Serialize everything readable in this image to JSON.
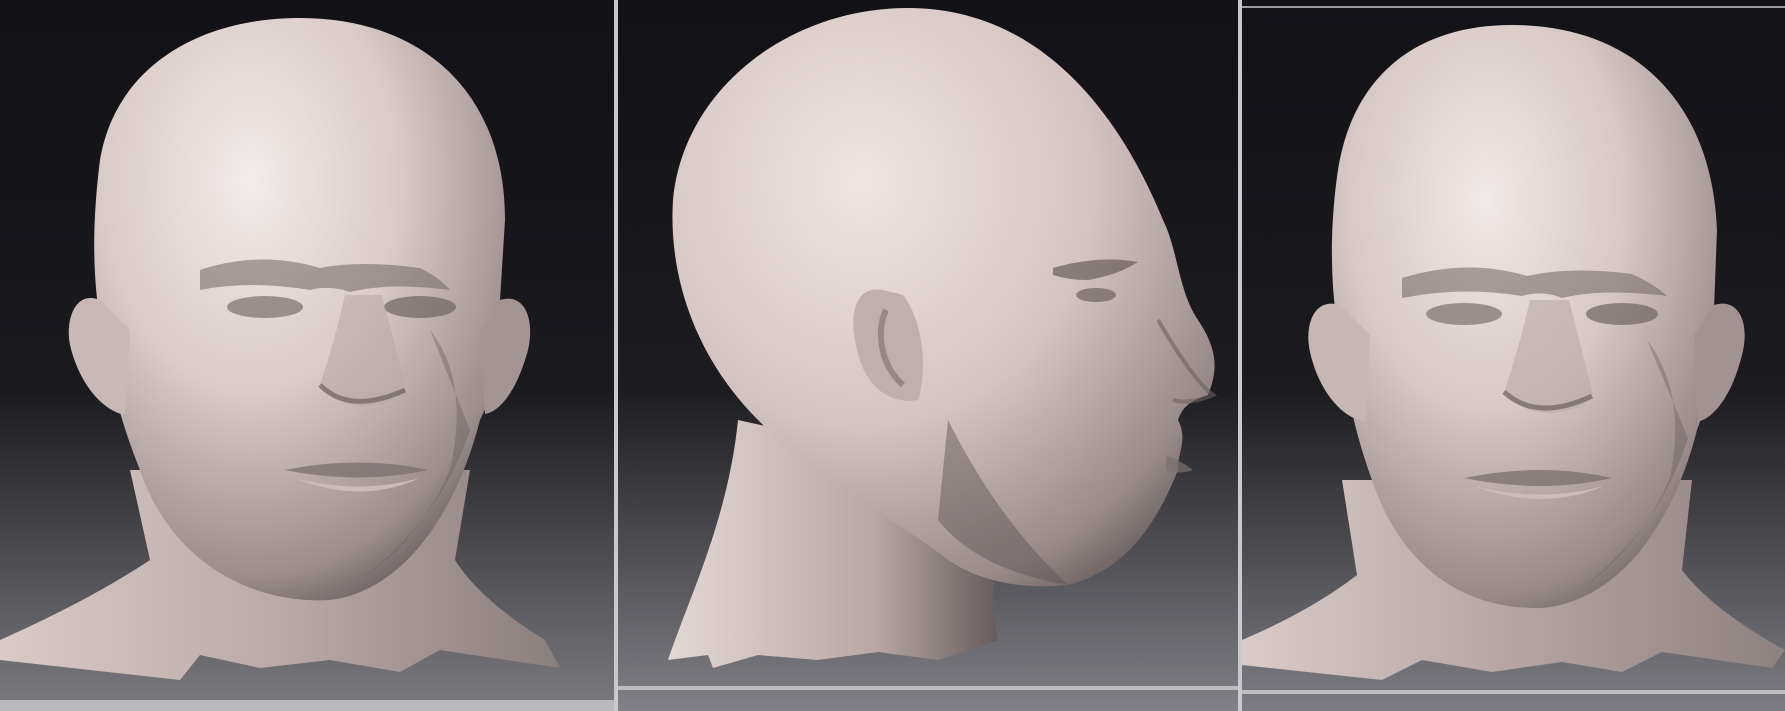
{
  "views": [
    {
      "id": "front",
      "kind": "3d-render"
    },
    {
      "id": "profile",
      "kind": "3d-render"
    },
    {
      "id": "three-quarter",
      "kind": "3d-render"
    }
  ],
  "colors": {
    "background_top": "#111116",
    "background_bottom": "#7b7b80",
    "skin_light": "#efe6e4",
    "skin_mid": "#c9b8b5",
    "skin_shadow": "#6e6462"
  }
}
